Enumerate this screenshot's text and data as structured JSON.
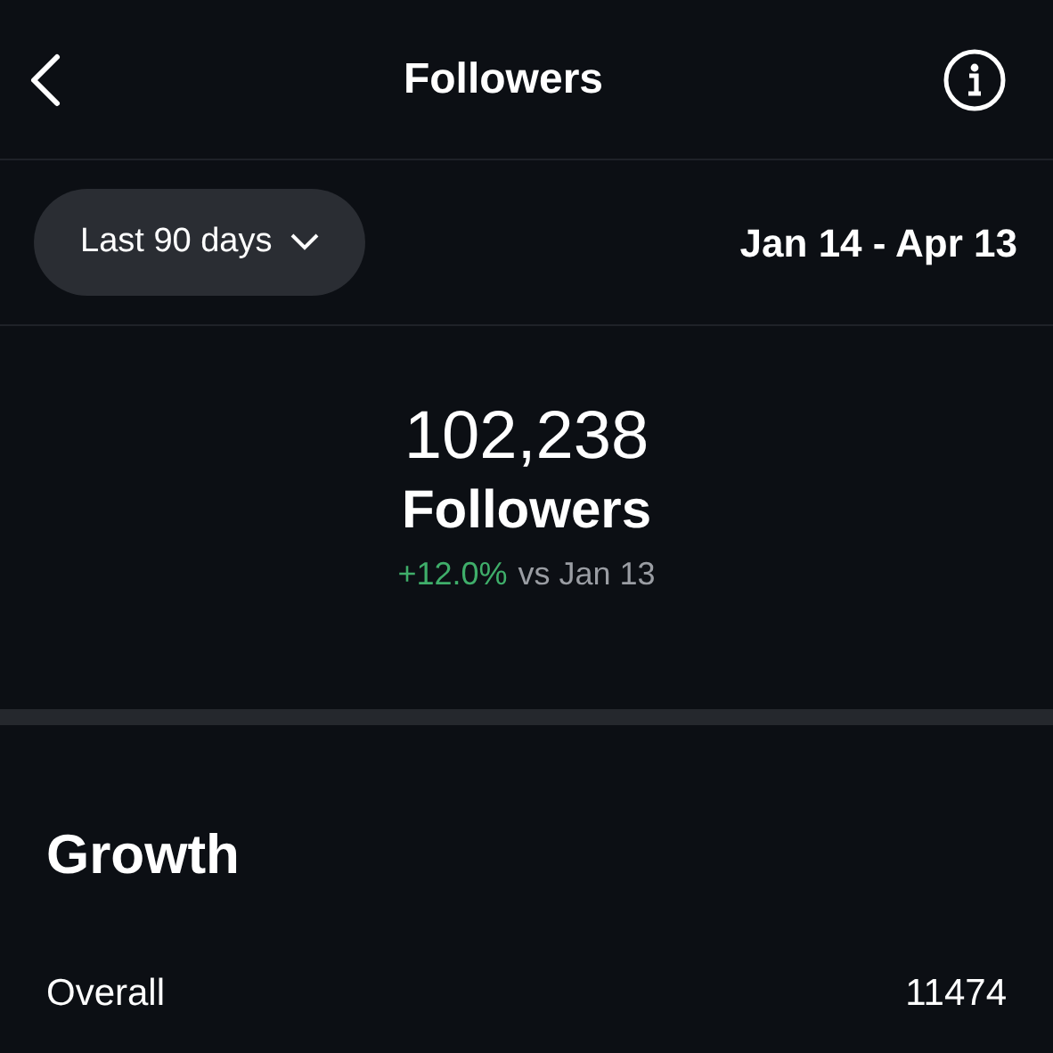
{
  "header": {
    "title": "Followers"
  },
  "range": {
    "label": "Last 90 days",
    "dates": "Jan 14 - Apr 13"
  },
  "summary": {
    "count": "102,238",
    "label": "Followers",
    "change": "+12.0%",
    "comparison": "vs Jan 13"
  },
  "growth": {
    "title": "Growth",
    "rows": [
      {
        "label": "Overall",
        "value": "11474"
      }
    ]
  }
}
